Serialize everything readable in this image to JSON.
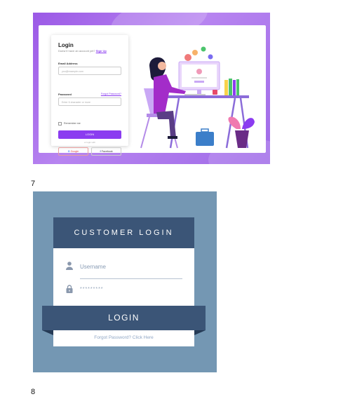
{
  "figure1": {
    "title": "Login",
    "subtitle_text": "Doesn't have an account yet?",
    "signup_link": "Sign Up",
    "email_label": "Email Address",
    "email_placeholder": "you@example.com",
    "password_label": "Password",
    "forgot_link": "Forgot Password?",
    "password_placeholder": "Enter 6 character or more",
    "remember_label": "Remember me",
    "login_button": "LOGIN",
    "or_text": "or login with",
    "google_button": "Google",
    "facebook_button": "Facebook",
    "accent_color": "#8b3cf0"
  },
  "caption1": "7",
  "figure2": {
    "header": "CUSTOMER LOGIN",
    "username_placeholder": "Username",
    "password_mask": "*********",
    "login_button": "LOGIN",
    "forgot_link": "Forgot Password? Click Here",
    "header_color": "#3b5577",
    "background_color": "#7497b3"
  },
  "caption2": "8"
}
